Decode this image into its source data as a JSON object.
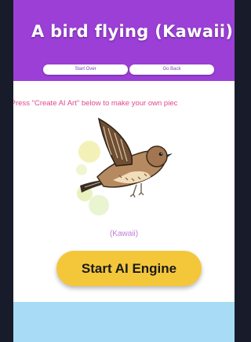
{
  "header": {
    "title": "A bird flying (Kawaii)",
    "buttons": {
      "start_over": "Start Over",
      "go_back": "Go Back"
    }
  },
  "main": {
    "prompt_text": "y? Press \"Create AI Art\" below to make your own piec",
    "art_alt": "Kawaii bird flying illustration",
    "caption": "(Kawaii)",
    "engine_button": "Start AI Engine"
  },
  "colors": {
    "header_bg": "#9b3fd6",
    "prompt_text": "#e0488c",
    "caption_text": "#c27ad8",
    "engine_button_bg": "#f4c73a",
    "footer_bg": "#a8dcf6"
  }
}
